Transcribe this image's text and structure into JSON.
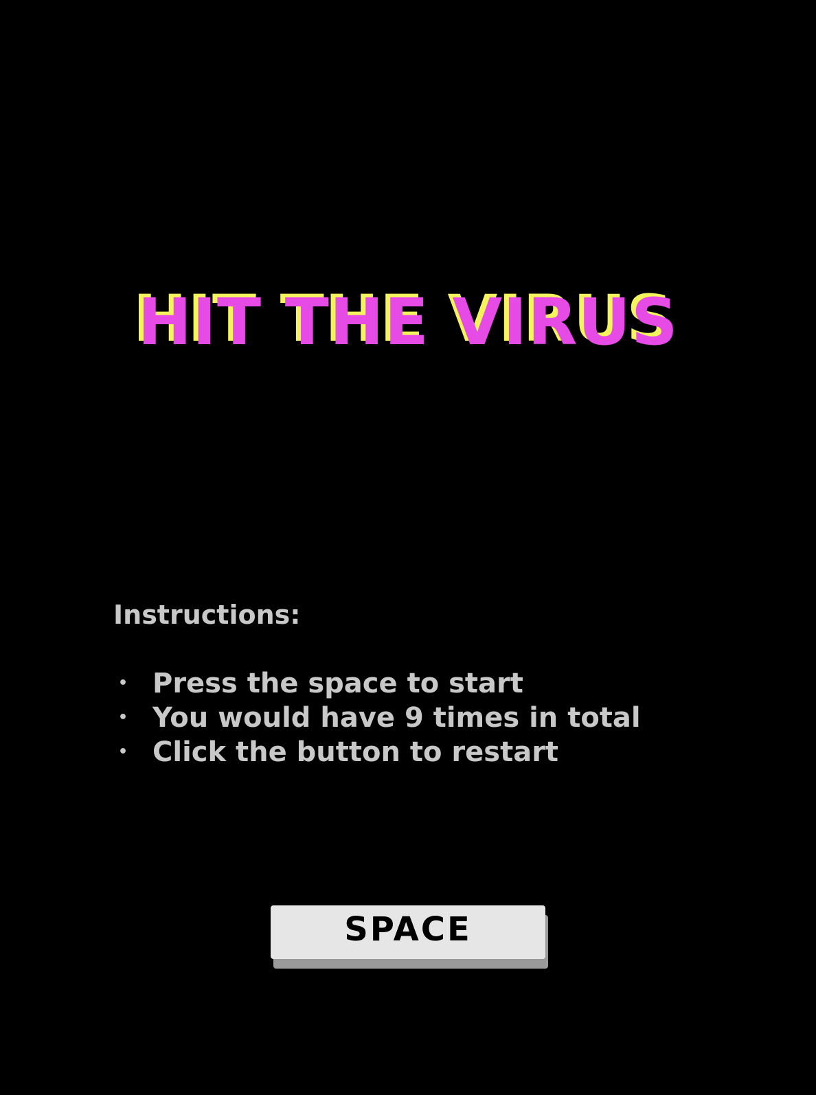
{
  "game": {
    "title": "HIT THE VIRUS",
    "instructions_heading": "Instructions:",
    "instructions": [
      "Press the space to start",
      "You would have 9 times in total",
      "Click the button to restart"
    ],
    "bullet": "•",
    "button_label": "SPACE"
  },
  "colors": {
    "background": "#000000",
    "title_primary": "#e64be6",
    "title_shadow": "#f4f45c",
    "text": "#c8c8c8",
    "button_face": "#e6e6e6",
    "button_shadow": "#9a9a9a"
  }
}
